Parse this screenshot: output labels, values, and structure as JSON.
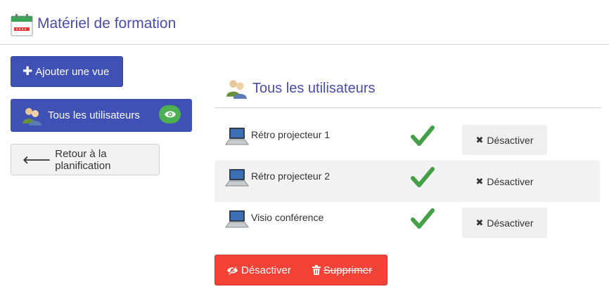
{
  "header": {
    "title": "Matériel de formation",
    "icon": "calendar-icon"
  },
  "sidebar": {
    "add_view_label": "Ajouter une vue",
    "all_users_label": "Tous les utilisateurs",
    "back_label": "Retour à la planification"
  },
  "section": {
    "title": "Tous les utilisateurs"
  },
  "items": [
    {
      "name": "Rétro projecteur 1",
      "status": "active",
      "action_label": "Désactiver"
    },
    {
      "name": "Rétro projecteur 2",
      "status": "active",
      "action_label": "Désactiver"
    },
    {
      "name": "Visio conférence",
      "status": "active",
      "action_label": "Désactiver"
    }
  ],
  "bulk_actions": {
    "deactivate_label": "Désactiver",
    "delete_label": "Supprimer"
  },
  "colors": {
    "primary": "#3f51b5",
    "title": "#4a4ca8",
    "success": "#4caf50",
    "danger": "#f44336"
  }
}
